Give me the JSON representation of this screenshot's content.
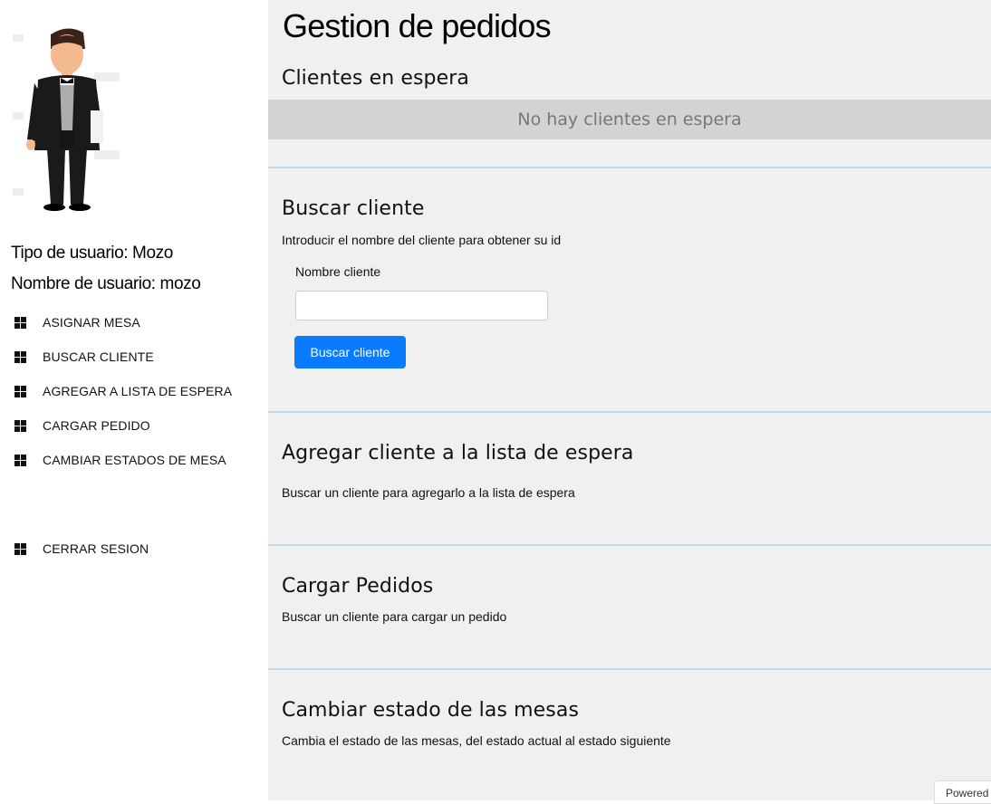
{
  "sidebar": {
    "user_type": "Tipo de usuario: Mozo",
    "user_name": "Nombre de usuario: mozo",
    "menu": [
      {
        "label": "ASIGNAR MESA",
        "icon": "grid-icon"
      },
      {
        "label": "BUSCAR CLIENTE",
        "icon": "grid-icon"
      },
      {
        "label": "AGREGAR A LISTA DE ESPERA",
        "icon": "grid-icon"
      },
      {
        "label": "CARGAR PEDIDO",
        "icon": "grid-icon"
      },
      {
        "label": "CAMBIAR ESTADOS DE MESA",
        "icon": "grid-icon"
      }
    ],
    "logout": {
      "label": "CERRAR SESION",
      "icon": "grid-icon"
    }
  },
  "main": {
    "title": "Gestion de pedidos",
    "waiting": {
      "title": "Clientes en espera",
      "empty_text": "No hay clientes en espera"
    },
    "search": {
      "title": "Buscar cliente",
      "description": "Introducir el nombre del cliente para obtener su id",
      "field_label": "Nombre cliente",
      "field_value": "",
      "button_label": "Buscar cliente"
    },
    "add_waitlist": {
      "title": "Agregar cliente a la lista de espera",
      "description": "Buscar un cliente para agregarlo a la lista de espera"
    },
    "orders": {
      "title": "Cargar Pedidos",
      "description": "Buscar un cliente para cargar un pedido"
    },
    "tables": {
      "title": "Cambiar estado de las mesas",
      "description": "Cambia el estado de las mesas, del estado actual al estado siguiente"
    }
  },
  "footer": {
    "powered": "Powered"
  },
  "colors": {
    "primary": "#0a7bff",
    "main_bg": "#f0f0f0",
    "divider": "#b9dbea"
  }
}
